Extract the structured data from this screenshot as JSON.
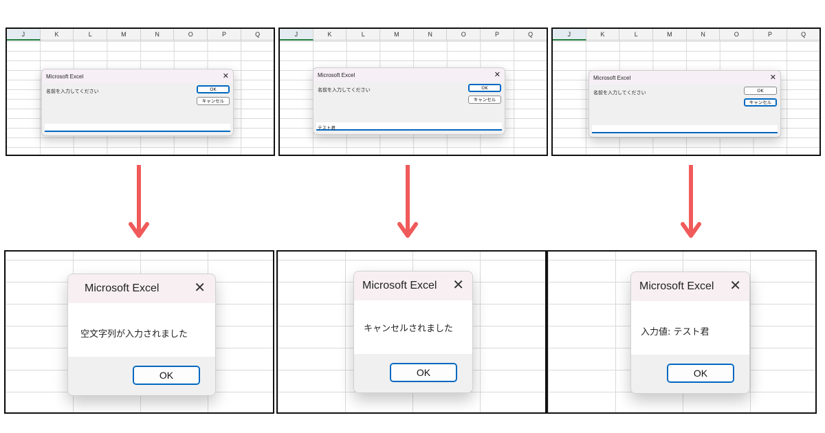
{
  "columns": [
    "J",
    "K",
    "L",
    "M",
    "N",
    "O",
    "P",
    "Q"
  ],
  "input_dialog": {
    "title": "Microsoft Excel",
    "close_glyph": "✕",
    "prompt": "名前を入力してください",
    "ok_label": "OK",
    "cancel_label": "キャンセル"
  },
  "scenarios": [
    {
      "input_value": "",
      "focused_button": "ok",
      "message": "空文字列が入力されました"
    },
    {
      "input_value": "テスト君",
      "focused_button": "ok",
      "message": "キャンセルされました"
    },
    {
      "input_value": "",
      "focused_button": "cancel",
      "message": "入力値: テスト君"
    }
  ],
  "message_dialog": {
    "title": "Microsoft Excel",
    "close_glyph": "✕",
    "ok_label": "OK"
  },
  "arrow_color": "#f05a5a",
  "accent_color": "#0067c0"
}
